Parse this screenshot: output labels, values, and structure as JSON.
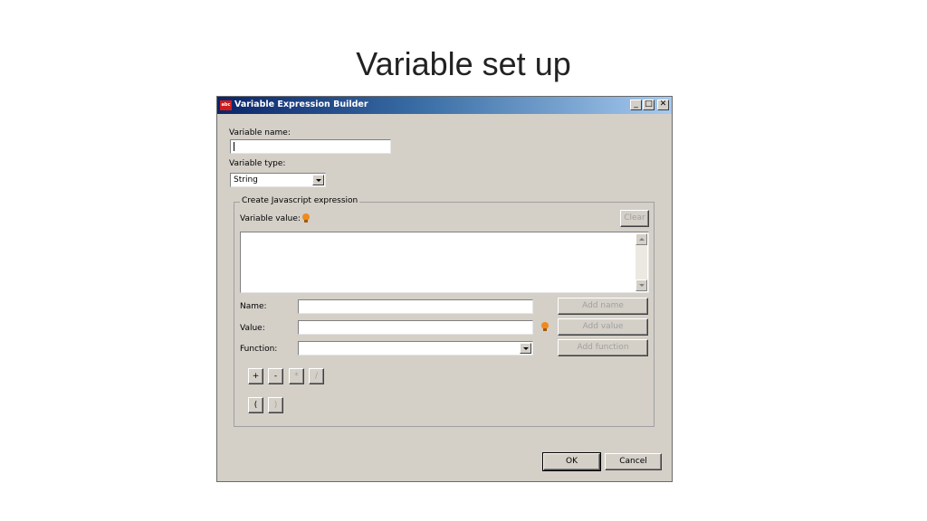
{
  "slide": {
    "title": "Variable set up"
  },
  "dialog": {
    "app_icon_text": "abc",
    "title": "Variable Expression Builder",
    "window_controls": {
      "minimize": "_",
      "maximize": "□",
      "close": "✕"
    },
    "variable_name_label": "Variable name:",
    "variable_name_value": "",
    "variable_type_label": "Variable type:",
    "variable_type_value": "String",
    "group_title": "Create Javascript expression",
    "variable_value_label": "Variable value:",
    "clear_label": "Clear",
    "name_label": "Name:",
    "value_label": "Value:",
    "function_label": "Function:",
    "add_name_label": "Add name",
    "add_value_label": "Add value",
    "add_function_label": "Add function",
    "operators": [
      "+",
      "-",
      "*",
      "/"
    ],
    "parens": [
      "(",
      ")"
    ],
    "ok_label": "OK",
    "cancel_label": "Cancel"
  },
  "colors": {
    "dialog_bg": "#d4d0c8",
    "titlebar_start": "#0a246a",
    "titlebar_end": "#a6caf0",
    "bulb": "#f08a1c"
  },
  "icons": [
    "app-icon",
    "bulb-icon",
    "chevron-down-icon",
    "scroll-up-icon",
    "scroll-down-icon"
  ]
}
